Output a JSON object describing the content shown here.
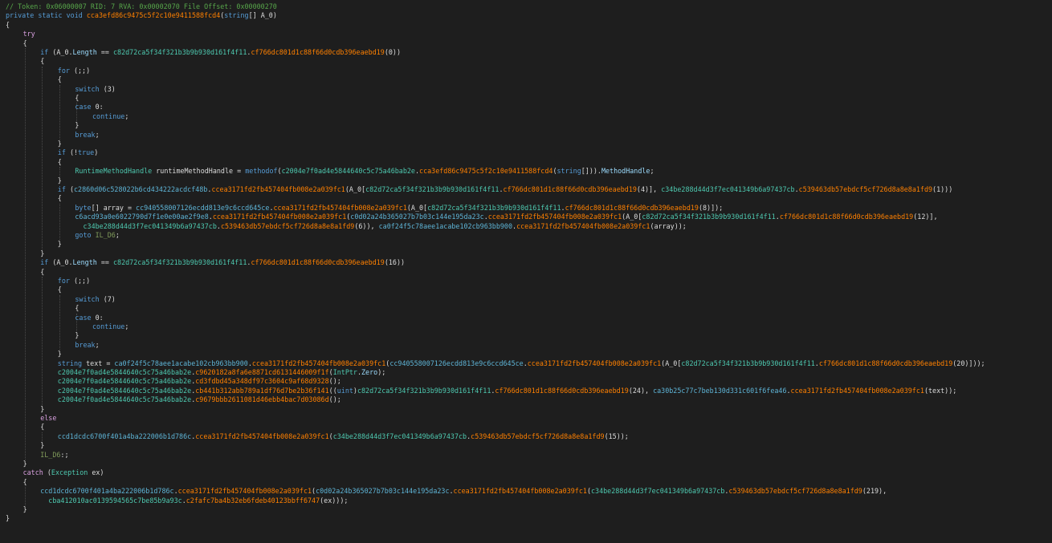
{
  "editor": {
    "language": "C#",
    "theme_background": "#1e1e1e",
    "token_colors": {
      "comment": "#57a64a",
      "keyword": "#569cd6",
      "control_keyword": "#d8a0df",
      "type": "#4ec9b0",
      "method": "#ff8000",
      "field": "#5eb4d6",
      "property": "#9cdcfe",
      "label": "#7f9a5a",
      "plain": "#dcdcdc"
    }
  },
  "lines": [
    {
      "indent": 0,
      "tokens": [
        [
          "c",
          "// Token: 0x06000007 RID: 7 RVA: 0x00002070 File Offset: 0x00000270"
        ]
      ]
    },
    {
      "indent": 0,
      "tokens": [
        [
          "k",
          "private static void "
        ],
        [
          "m",
          "cca3efd86c9475c5f2c10e9411588fcd4"
        ],
        [
          "w",
          "("
        ],
        [
          "k",
          "string"
        ],
        [
          "w",
          "[] A_0)"
        ]
      ]
    },
    {
      "indent": 0,
      "tokens": [
        [
          "w",
          "{"
        ]
      ]
    },
    {
      "indent": 1,
      "tokens": [
        [
          "kc",
          "try"
        ]
      ]
    },
    {
      "indent": 1,
      "tokens": [
        [
          "w",
          "{"
        ]
      ]
    },
    {
      "indent": 2,
      "tokens": [
        [
          "k",
          "if "
        ],
        [
          "w",
          "(A_0."
        ],
        [
          "p",
          "Length"
        ],
        [
          "w",
          " == "
        ],
        [
          "t",
          "c82d72ca5f34f321b3b9b930d161f4f11"
        ],
        [
          "w",
          "."
        ],
        [
          "m",
          "cf766dc801d1c88f66d0cdb396eaebd19"
        ],
        [
          "w",
          "(0))"
        ]
      ]
    },
    {
      "indent": 2,
      "tokens": [
        [
          "w",
          "{"
        ]
      ]
    },
    {
      "indent": 3,
      "tokens": [
        [
          "k",
          "for "
        ],
        [
          "w",
          "(;;)"
        ]
      ]
    },
    {
      "indent": 3,
      "tokens": [
        [
          "w",
          "{"
        ]
      ]
    },
    {
      "indent": 4,
      "tokens": [
        [
          "k",
          "switch "
        ],
        [
          "w",
          "(3)"
        ]
      ]
    },
    {
      "indent": 4,
      "tokens": [
        [
          "w",
          "{"
        ]
      ]
    },
    {
      "indent": 4,
      "tokens": [
        [
          "k",
          "case "
        ],
        [
          "w",
          "0:"
        ]
      ]
    },
    {
      "indent": 5,
      "tokens": [
        [
          "k",
          "continue"
        ],
        [
          "w",
          ";"
        ]
      ]
    },
    {
      "indent": 4,
      "tokens": [
        [
          "w",
          "}"
        ]
      ]
    },
    {
      "indent": 4,
      "tokens": [
        [
          "k",
          "break"
        ],
        [
          "w",
          ";"
        ]
      ]
    },
    {
      "indent": 3,
      "tokens": [
        [
          "w",
          "}"
        ]
      ]
    },
    {
      "indent": 3,
      "tokens": [
        [
          "k",
          "if "
        ],
        [
          "w",
          "(!"
        ],
        [
          "k",
          "true"
        ],
        [
          "w",
          ")"
        ]
      ]
    },
    {
      "indent": 3,
      "tokens": [
        [
          "w",
          "{"
        ]
      ]
    },
    {
      "indent": 4,
      "tokens": [
        [
          "t",
          "RuntimeMethodHandle"
        ],
        [
          "w",
          " runtimeMethodHandle = "
        ],
        [
          "k",
          "methodof"
        ],
        [
          "w",
          "("
        ],
        [
          "t",
          "c2004e7f0ad4e5844640c5c75a46bab2e"
        ],
        [
          "w",
          "."
        ],
        [
          "m",
          "cca3efd86c9475c5f2c10e9411588fcd4"
        ],
        [
          "w",
          "("
        ],
        [
          "k",
          "string"
        ],
        [
          "w",
          "[]))."
        ],
        [
          "p",
          "MethodHandle"
        ],
        [
          "w",
          ";"
        ]
      ]
    },
    {
      "indent": 3,
      "tokens": [
        [
          "w",
          "}"
        ]
      ]
    },
    {
      "indent": 3,
      "tokens": [
        [
          "k",
          "if "
        ],
        [
          "w",
          "("
        ],
        [
          "f",
          "c2860d06c528022b6cd434222acdcf48b"
        ],
        [
          "w",
          "."
        ],
        [
          "m",
          "ccea3171fd2fb457404fb008e2a039fc1"
        ],
        [
          "w",
          "(A_0["
        ],
        [
          "t",
          "c82d72ca5f34f321b3b9b930d161f4f11"
        ],
        [
          "w",
          "."
        ],
        [
          "m",
          "cf766dc801d1c88f66d0cdb396eaebd19"
        ],
        [
          "w",
          "(4)], "
        ],
        [
          "t",
          "c34be288d44d3f7ec041349b6a97437cb"
        ],
        [
          "w",
          "."
        ],
        [
          "m",
          "c539463db57ebdcf5cf726d8a8e8a1fd9"
        ],
        [
          "w",
          "(1)))"
        ]
      ]
    },
    {
      "indent": 3,
      "tokens": [
        [
          "w",
          "{"
        ]
      ]
    },
    {
      "indent": 4,
      "tokens": [
        [
          "k",
          "byte"
        ],
        [
          "w",
          "[] array = "
        ],
        [
          "f",
          "cc940558007126ecdd813e9c6ccd645ce"
        ],
        [
          "w",
          "."
        ],
        [
          "m",
          "ccea3171fd2fb457404fb008e2a039fc1"
        ],
        [
          "w",
          "(A_0["
        ],
        [
          "t",
          "c82d72ca5f34f321b3b9b930d161f4f11"
        ],
        [
          "w",
          "."
        ],
        [
          "m",
          "cf766dc801d1c88f66d0cdb396eaebd19"
        ],
        [
          "w",
          "(8)]);"
        ]
      ]
    },
    {
      "indent": 4,
      "tokens": [
        [
          "f",
          "c6acd93a0e6022790d7f1e0e00ae2f9e8"
        ],
        [
          "w",
          "."
        ],
        [
          "m",
          "ccea3171fd2fb457404fb008e2a039fc1"
        ],
        [
          "w",
          "("
        ],
        [
          "f",
          "c0d02a24b365027b7b03c144e195da23c"
        ],
        [
          "w",
          "."
        ],
        [
          "m",
          "ccea3171fd2fb457404fb008e2a039fc1"
        ],
        [
          "w",
          "(A_0["
        ],
        [
          "t",
          "c82d72ca5f34f321b3b9b930d161f4f11"
        ],
        [
          "w",
          "."
        ],
        [
          "m",
          "cf766dc801d1c88f66d0cdb396eaebd19"
        ],
        [
          "w",
          "(12)],"
        ]
      ]
    },
    {
      "indent": 4,
      "pad": "  ",
      "tokens": [
        [
          "t",
          "c34be288d44d3f7ec041349b6a97437cb"
        ],
        [
          "w",
          "."
        ],
        [
          "m",
          "c539463db57ebdcf5cf726d8a8e8a1fd9"
        ],
        [
          "w",
          "(6)), "
        ],
        [
          "f",
          "ca0f24f5c78aee1acabe102cb963bb900"
        ],
        [
          "w",
          "."
        ],
        [
          "m",
          "ccea3171fd2fb457404fb008e2a039fc1"
        ],
        [
          "w",
          "(array));"
        ]
      ]
    },
    {
      "indent": 4,
      "tokens": [
        [
          "k",
          "goto "
        ],
        [
          "g",
          "IL_D6"
        ],
        [
          "w",
          ";"
        ]
      ]
    },
    {
      "indent": 3,
      "tokens": [
        [
          "w",
          "}"
        ]
      ]
    },
    {
      "indent": 2,
      "tokens": [
        [
          "w",
          "}"
        ]
      ]
    },
    {
      "indent": 2,
      "tokens": [
        [
          "k",
          "if "
        ],
        [
          "w",
          "(A_0."
        ],
        [
          "p",
          "Length"
        ],
        [
          "w",
          " == "
        ],
        [
          "t",
          "c82d72ca5f34f321b3b9b930d161f4f11"
        ],
        [
          "w",
          "."
        ],
        [
          "m",
          "cf766dc801d1c88f66d0cdb396eaebd19"
        ],
        [
          "w",
          "(16))"
        ]
      ]
    },
    {
      "indent": 2,
      "tokens": [
        [
          "w",
          "{"
        ]
      ]
    },
    {
      "indent": 3,
      "tokens": [
        [
          "k",
          "for "
        ],
        [
          "w",
          "(;;)"
        ]
      ]
    },
    {
      "indent": 3,
      "tokens": [
        [
          "w",
          "{"
        ]
      ]
    },
    {
      "indent": 4,
      "tokens": [
        [
          "k",
          "switch "
        ],
        [
          "w",
          "(7)"
        ]
      ]
    },
    {
      "indent": 4,
      "tokens": [
        [
          "w",
          "{"
        ]
      ]
    },
    {
      "indent": 4,
      "tokens": [
        [
          "k",
          "case "
        ],
        [
          "w",
          "0:"
        ]
      ]
    },
    {
      "indent": 5,
      "tokens": [
        [
          "k",
          "continue"
        ],
        [
          "w",
          ";"
        ]
      ]
    },
    {
      "indent": 4,
      "tokens": [
        [
          "w",
          "}"
        ]
      ]
    },
    {
      "indent": 4,
      "tokens": [
        [
          "k",
          "break"
        ],
        [
          "w",
          ";"
        ]
      ]
    },
    {
      "indent": 3,
      "tokens": [
        [
          "w",
          "}"
        ]
      ]
    },
    {
      "indent": 3,
      "tokens": [
        [
          "k",
          "string"
        ],
        [
          "w",
          " text = "
        ],
        [
          "f",
          "ca0f24f5c78aee1acabe102cb963bb900"
        ],
        [
          "w",
          "."
        ],
        [
          "m",
          "ccea3171fd2fb457404fb008e2a039fc1"
        ],
        [
          "w",
          "("
        ],
        [
          "f",
          "cc940558007126ecdd813e9c6ccd645ce"
        ],
        [
          "w",
          "."
        ],
        [
          "m",
          "ccea3171fd2fb457404fb008e2a039fc1"
        ],
        [
          "w",
          "(A_0["
        ],
        [
          "t",
          "c82d72ca5f34f321b3b9b930d161f4f11"
        ],
        [
          "w",
          "."
        ],
        [
          "m",
          "cf766dc801d1c88f66d0cdb396eaebd19"
        ],
        [
          "w",
          "(20)]));"
        ]
      ]
    },
    {
      "indent": 3,
      "tokens": [
        [
          "t",
          "c2004e7f0ad4e5844640c5c75a46bab2e"
        ],
        [
          "w",
          "."
        ],
        [
          "m",
          "c9620182a8fa6e8871cd6131446009f1f"
        ],
        [
          "w",
          "("
        ],
        [
          "t",
          "IntPtr"
        ],
        [
          "w",
          "."
        ],
        [
          "p",
          "Zero"
        ],
        [
          "w",
          ");"
        ]
      ]
    },
    {
      "indent": 3,
      "tokens": [
        [
          "t",
          "c2004e7f0ad4e5844640c5c75a46bab2e"
        ],
        [
          "w",
          "."
        ],
        [
          "m",
          "cd3fdbd45a348df97c3604c9af68d9328"
        ],
        [
          "w",
          "();"
        ]
      ]
    },
    {
      "indent": 3,
      "tokens": [
        [
          "t",
          "c2004e7f0ad4e5844640c5c75a46bab2e"
        ],
        [
          "w",
          "."
        ],
        [
          "m",
          "cb441b312abb789a1df76d7be2b36f141"
        ],
        [
          "w",
          "(("
        ],
        [
          "k",
          "uint"
        ],
        [
          "w",
          ")"
        ],
        [
          "t",
          "c82d72ca5f34f321b3b9b930d161f4f11"
        ],
        [
          "w",
          "."
        ],
        [
          "m",
          "cf766dc801d1c88f66d0cdb396eaebd19"
        ],
        [
          "w",
          "(24), "
        ],
        [
          "f",
          "ca30b25c77c7beb130d331c601f6fea46"
        ],
        [
          "w",
          "."
        ],
        [
          "m",
          "ccea3171fd2fb457404fb008e2a039fc1"
        ],
        [
          "w",
          "(text));"
        ]
      ]
    },
    {
      "indent": 3,
      "tokens": [
        [
          "t",
          "c2004e7f0ad4e5844640c5c75a46bab2e"
        ],
        [
          "w",
          "."
        ],
        [
          "m",
          "c9679bbb2611081d46ebb4bac7d03086d"
        ],
        [
          "w",
          "();"
        ]
      ]
    },
    {
      "indent": 2,
      "tokens": [
        [
          "w",
          "}"
        ]
      ]
    },
    {
      "indent": 2,
      "tokens": [
        [
          "kc",
          "else"
        ]
      ]
    },
    {
      "indent": 2,
      "tokens": [
        [
          "w",
          "{"
        ]
      ]
    },
    {
      "indent": 3,
      "tokens": [
        [
          "f",
          "ccd1dcdc6700f401a4ba222006b1d786c"
        ],
        [
          "w",
          "."
        ],
        [
          "m",
          "ccea3171fd2fb457404fb008e2a039fc1"
        ],
        [
          "w",
          "("
        ],
        [
          "t",
          "c34be288d44d3f7ec041349b6a97437cb"
        ],
        [
          "w",
          "."
        ],
        [
          "m",
          "c539463db57ebdcf5cf726d8a8e8a1fd9"
        ],
        [
          "w",
          "(15));"
        ]
      ]
    },
    {
      "indent": 2,
      "tokens": [
        [
          "w",
          "}"
        ]
      ]
    },
    {
      "indent": 2,
      "tokens": [
        [
          "g",
          "IL_D6"
        ],
        [
          "w",
          ":;"
        ]
      ]
    },
    {
      "indent": 1,
      "tokens": [
        [
          "w",
          "}"
        ]
      ]
    },
    {
      "indent": 1,
      "tokens": [
        [
          "kc",
          "catch "
        ],
        [
          "w",
          "("
        ],
        [
          "t",
          "Exception"
        ],
        [
          "w",
          " ex)"
        ]
      ]
    },
    {
      "indent": 1,
      "tokens": [
        [
          "w",
          "{"
        ]
      ]
    },
    {
      "indent": 2,
      "tokens": [
        [
          "f",
          "ccd1dcdc6700f401a4ba222006b1d786c"
        ],
        [
          "w",
          "."
        ],
        [
          "m",
          "ccea3171fd2fb457404fb008e2a039fc1"
        ],
        [
          "w",
          "("
        ],
        [
          "f",
          "c0d02a24b365027b7b03c144e195da23c"
        ],
        [
          "w",
          "."
        ],
        [
          "m",
          "ccea3171fd2fb457404fb008e2a039fc1"
        ],
        [
          "w",
          "("
        ],
        [
          "t",
          "c34be288d44d3f7ec041349b6a97437cb"
        ],
        [
          "w",
          "."
        ],
        [
          "m",
          "c539463db57ebdcf5cf726d8a8e8a1fd9"
        ],
        [
          "w",
          "(219),"
        ]
      ]
    },
    {
      "indent": 2,
      "pad": "  ",
      "tokens": [
        [
          "t",
          "cba412010ac0139594565c7be85b9a93c"
        ],
        [
          "w",
          "."
        ],
        [
          "m",
          "c2fafc7ba4b32eb6fdeb40123bbff6747"
        ],
        [
          "w",
          "(ex)));"
        ]
      ]
    },
    {
      "indent": 1,
      "tokens": [
        [
          "w",
          "}"
        ]
      ]
    },
    {
      "indent": 0,
      "tokens": [
        [
          "w",
          "}"
        ]
      ]
    }
  ]
}
